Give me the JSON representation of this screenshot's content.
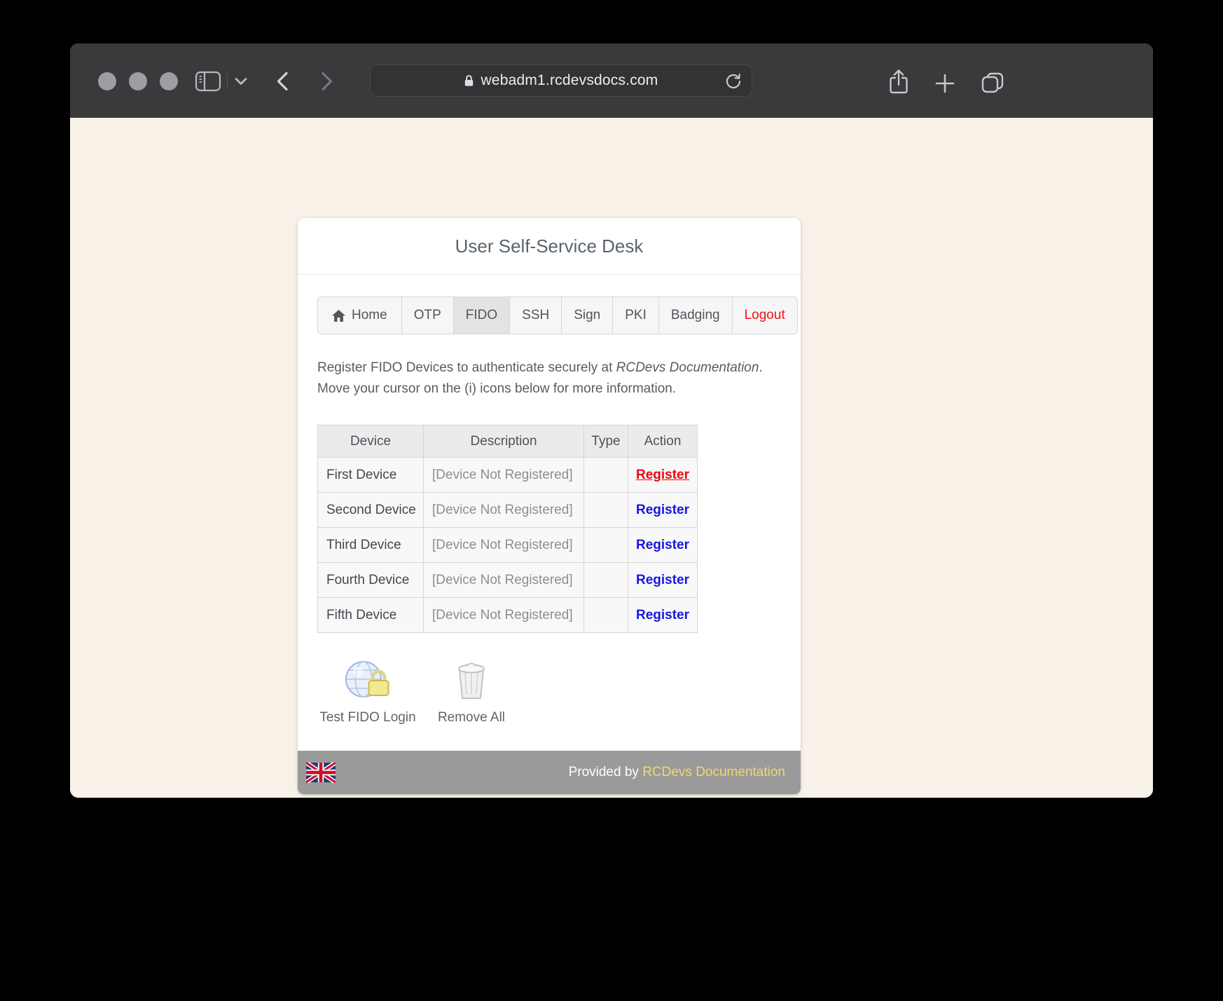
{
  "browser": {
    "url": "webadm1.rcdevsdocs.com"
  },
  "page": {
    "title": "User Self-Service Desk",
    "nav": {
      "tabs": [
        {
          "label": "Home"
        },
        {
          "label": "OTP"
        },
        {
          "label": "FIDO"
        },
        {
          "label": "SSH"
        },
        {
          "label": "Sign"
        },
        {
          "label": "PKI"
        },
        {
          "label": "Badging"
        },
        {
          "label": "Logout"
        }
      ],
      "active_tab": "FIDO"
    },
    "intro": {
      "line1_prefix": "Register FIDO Devices to authenticate securely at ",
      "line1_em": "RCDevs Documentation",
      "line1_suffix": ".",
      "line2": "Move your cursor on the (i) icons below for more information."
    },
    "table": {
      "headers": [
        "Device",
        "Description",
        "Type",
        "Action"
      ],
      "rows": [
        {
          "device": "First Device",
          "description": "[Device Not Registered]",
          "type": "",
          "action": "Register"
        },
        {
          "device": "Second Device",
          "description": "[Device Not Registered]",
          "type": "",
          "action": "Register"
        },
        {
          "device": "Third Device",
          "description": "[Device Not Registered]",
          "type": "",
          "action": "Register"
        },
        {
          "device": "Fourth Device",
          "description": "[Device Not Registered]",
          "type": "",
          "action": "Register"
        },
        {
          "device": "Fifth Device",
          "description": "[Device Not Registered]",
          "type": "",
          "action": "Register"
        }
      ]
    },
    "actions": [
      {
        "label": "Test FIDO Login",
        "icon": "globe-lock-icon"
      },
      {
        "label": "Remove All",
        "icon": "trash-icon"
      }
    ],
    "footer": {
      "provided_by": "Provided by ",
      "link_label": "RCDevs Documentation"
    }
  },
  "colors": {
    "register_highlight_red": "#ee0514",
    "register_link_blue": "#1717e0",
    "logout_red": "#f50f0f",
    "footer_bg": "#9a9a9a",
    "footer_link_yellow": "#f2d671",
    "page_bg": "#f7f1e7"
  }
}
